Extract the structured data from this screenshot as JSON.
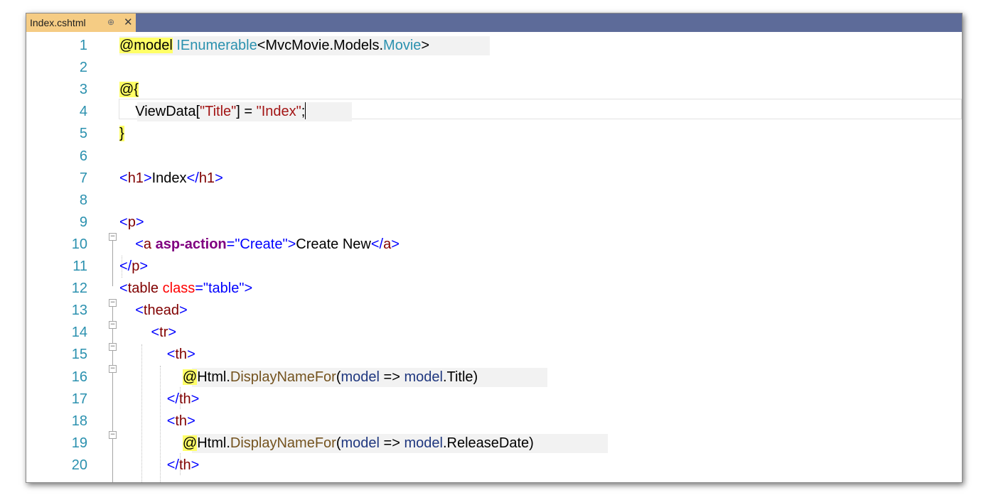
{
  "tab": {
    "title": "Index.cshtml",
    "pin_icon": "pin-icon",
    "pin_glyph": "⊕",
    "close_icon": "close-icon",
    "close_glyph": "✕"
  },
  "lines": [
    {
      "n": "1",
      "parts": [
        [
          "@model",
          "hl"
        ],
        [
          " ",
          ""
        ],
        [
          "IEnumerable",
          "ty"
        ],
        [
          "<MvcMovie.Models.",
          ""
        ],
        [
          "Movie",
          "ty"
        ],
        [
          ">",
          ""
        ]
      ]
    },
    {
      "n": "2",
      "parts": []
    },
    {
      "n": "3",
      "parts": [
        [
          "@{",
          "hl"
        ]
      ]
    },
    {
      "n": "4",
      "parts": [
        [
          "    ViewData[",
          ""
        ],
        [
          "\"Title\"",
          "str"
        ],
        [
          "] = ",
          ""
        ],
        [
          "\"Index\"",
          "str"
        ],
        [
          ";",
          ""
        ]
      ]
    },
    {
      "n": "5",
      "parts": [
        [
          "}",
          "hl"
        ]
      ]
    },
    {
      "n": "6",
      "parts": []
    },
    {
      "n": "7",
      "parts": [
        [
          "<",
          "kw"
        ],
        [
          "h1",
          "el"
        ],
        [
          ">",
          "kw"
        ],
        [
          "Index",
          ""
        ],
        [
          "</",
          "kw"
        ],
        [
          "h1",
          "el"
        ],
        [
          ">",
          "kw"
        ]
      ]
    },
    {
      "n": "8",
      "parts": []
    },
    {
      "n": "9",
      "parts": [
        [
          "<",
          "kw"
        ],
        [
          "p",
          "el"
        ],
        [
          ">",
          "kw"
        ]
      ]
    },
    {
      "n": "10",
      "parts": [
        [
          "    ",
          ""
        ],
        [
          "<",
          "kw"
        ],
        [
          "a",
          "el"
        ],
        [
          " ",
          ""
        ],
        [
          "asp-action",
          "atb"
        ],
        [
          "=",
          "kw"
        ],
        [
          "\"Create\"",
          "kw"
        ],
        [
          ">",
          "kw"
        ],
        [
          "Create New",
          ""
        ],
        [
          "</",
          "kw"
        ],
        [
          "a",
          "el"
        ],
        [
          ">",
          "kw"
        ]
      ]
    },
    {
      "n": "11",
      "parts": [
        [
          "</",
          "kw"
        ],
        [
          "p",
          "el"
        ],
        [
          ">",
          "kw"
        ]
      ]
    },
    {
      "n": "12",
      "parts": [
        [
          "<",
          "kw"
        ],
        [
          "table",
          "el"
        ],
        [
          " ",
          ""
        ],
        [
          "class",
          "at"
        ],
        [
          "=",
          "kw"
        ],
        [
          "\"table\"",
          "kw"
        ],
        [
          ">",
          "kw"
        ]
      ]
    },
    {
      "n": "13",
      "parts": [
        [
          "    ",
          ""
        ],
        [
          "<",
          "kw"
        ],
        [
          "thead",
          "el"
        ],
        [
          ">",
          "kw"
        ]
      ]
    },
    {
      "n": "14",
      "parts": [
        [
          "        ",
          ""
        ],
        [
          "<",
          "kw"
        ],
        [
          "tr",
          "el"
        ],
        [
          ">",
          "kw"
        ]
      ]
    },
    {
      "n": "15",
      "parts": [
        [
          "            ",
          ""
        ],
        [
          "<",
          "kw"
        ],
        [
          "th",
          "el"
        ],
        [
          ">",
          "kw"
        ]
      ]
    },
    {
      "n": "16",
      "parts": [
        [
          "                ",
          ""
        ],
        [
          "@",
          "hl"
        ],
        [
          "Html.",
          ""
        ],
        [
          "DisplayNameFor",
          "me"
        ],
        [
          "(",
          ""
        ],
        [
          "model",
          "pa"
        ],
        [
          " => ",
          ""
        ],
        [
          "model",
          "pa"
        ],
        [
          ".Title)",
          ""
        ]
      ]
    },
    {
      "n": "17",
      "parts": [
        [
          "            ",
          ""
        ],
        [
          "</",
          "kw"
        ],
        [
          "th",
          "el"
        ],
        [
          ">",
          "kw"
        ]
      ]
    },
    {
      "n": "18",
      "parts": [
        [
          "            ",
          ""
        ],
        [
          "<",
          "kw"
        ],
        [
          "th",
          "el"
        ],
        [
          ">",
          "kw"
        ]
      ]
    },
    {
      "n": "19",
      "parts": [
        [
          "                ",
          ""
        ],
        [
          "@",
          "hl"
        ],
        [
          "Html.",
          ""
        ],
        [
          "DisplayNameFor",
          "me"
        ],
        [
          "(",
          ""
        ],
        [
          "model",
          "pa"
        ],
        [
          " => ",
          ""
        ],
        [
          "model",
          "pa"
        ],
        [
          ".ReleaseDate)",
          ""
        ]
      ]
    },
    {
      "n": "20",
      "parts": [
        [
          "            ",
          ""
        ],
        [
          "</",
          "kw"
        ],
        [
          "th",
          "el"
        ],
        [
          ">",
          "kw"
        ]
      ]
    }
  ],
  "colors": {
    "tabbar": "#5d6b99",
    "active_tab": "#f5cc84",
    "line_number": "#2b91af",
    "razor_highlight": "#ffff66"
  }
}
